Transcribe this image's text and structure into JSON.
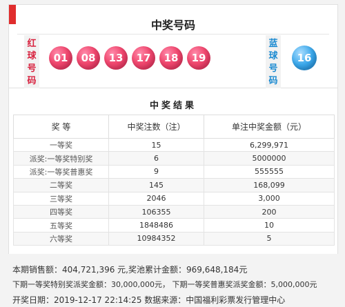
{
  "winning_numbers": {
    "title": "中奖号码",
    "red_label": [
      "红",
      "球",
      "号",
      "码"
    ],
    "blue_label": [
      "蓝",
      "球",
      "号",
      "码"
    ],
    "red_balls": [
      "01",
      "08",
      "13",
      "17",
      "18",
      "19"
    ],
    "blue_ball": "16",
    "colors": {
      "red_ball": "#f0486f",
      "blue_ball": "#3aa7ea",
      "accent": "#e02d2d"
    }
  },
  "results": {
    "title": "中奖结果",
    "headers": [
      "奖 等",
      "中奖注数（注）",
      "单注中奖金额（元）"
    ],
    "rows": [
      [
        "一等奖",
        "15",
        "6,299,971"
      ],
      [
        "派奖:一等奖特别奖",
        "6",
        "5000000"
      ],
      [
        "派奖:一等奖普惠奖",
        "9",
        "555555"
      ],
      [
        "二等奖",
        "145",
        "168,099"
      ],
      [
        "三等奖",
        "2046",
        "3,000"
      ],
      [
        "四等奖",
        "106355",
        "200"
      ],
      [
        "五等奖",
        "1848486",
        "10"
      ],
      [
        "六等奖",
        "10984352",
        "5"
      ]
    ]
  },
  "footer": {
    "sales_line": "本期销售额：404,721,396 元,奖池累计金额：969,648,184元",
    "next_line": "下期一等奖特别奖派奖金额：30,000,000元，  下期一等奖普惠奖派奖金额：5,000,000元",
    "date_line": "开奖日期：2019-12-17 22:14:25  数据来源：中国福利彩票发行管理中心"
  }
}
